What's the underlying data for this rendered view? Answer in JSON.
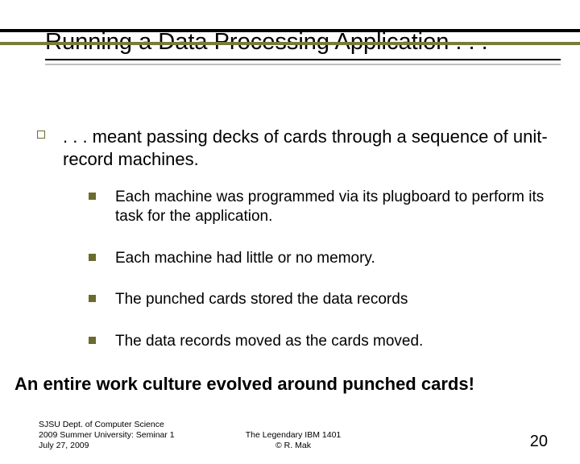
{
  "title": "Running a Data Processing Application . . .",
  "main_bullet": ". . . meant passing decks of cards through a sequence of unit-record machines.",
  "sub_bullets": [
    "Each machine was programmed via its plugboard to perform its task for the application.",
    "Each machine had little or no memory.",
    "The punched cards stored the data records",
    "The data records moved as the cards moved."
  ],
  "callout": "An entire work culture evolved around punched cards!",
  "footer": {
    "left_line1": "SJSU Dept. of Computer Science",
    "left_line2": "2009 Summer University: Seminar 1",
    "left_line3": "July 27, 2009",
    "center_line1": "The Legendary IBM 1401",
    "center_line2": "© R. Mak",
    "page_number": "20"
  }
}
